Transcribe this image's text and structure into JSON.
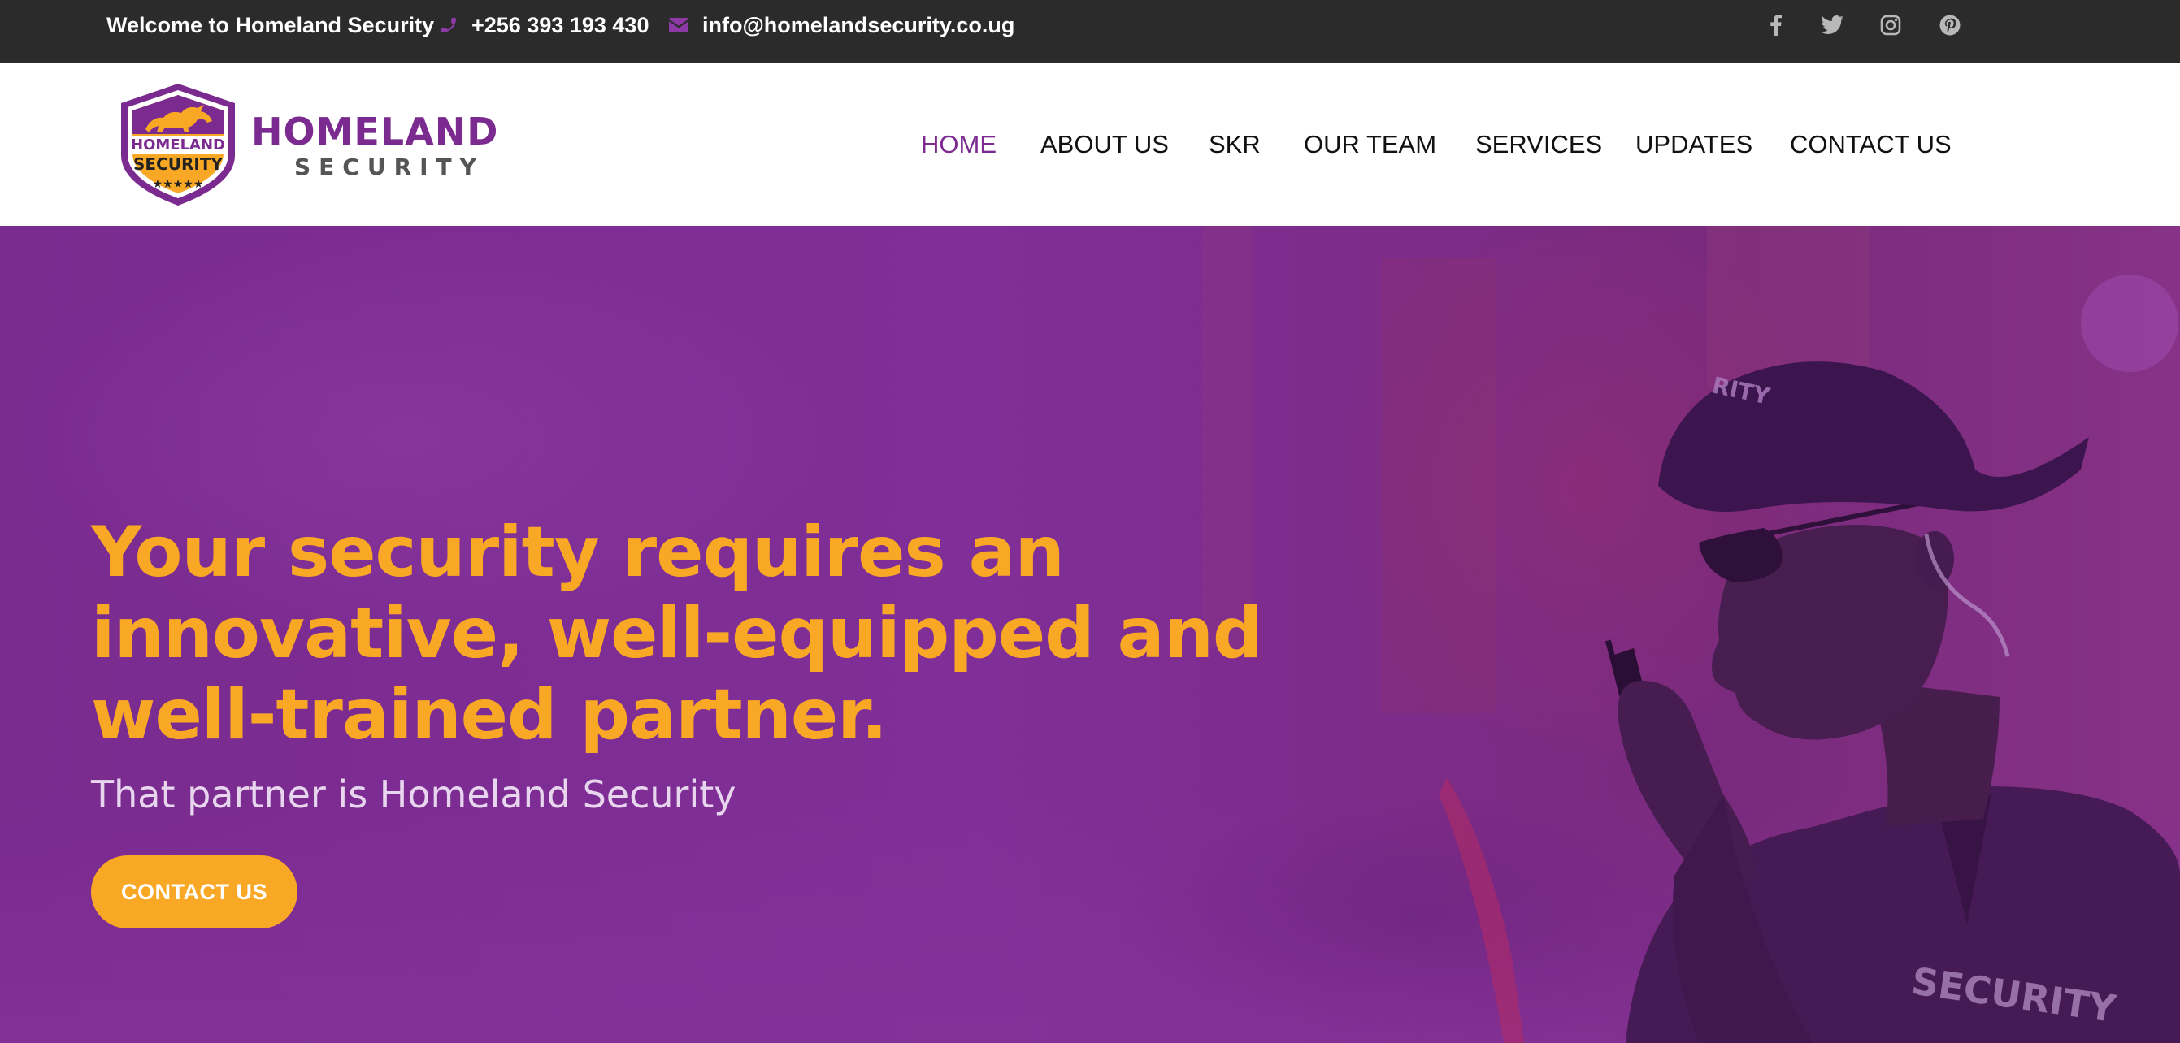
{
  "topbar": {
    "welcome": "Welcome to Homeland Security",
    "phone": "+256 393 193 430",
    "email": "info@homelandsecurity.co.ug",
    "icons": {
      "phone": "phone-icon",
      "email": "envelope-icon"
    },
    "social": [
      "facebook-icon",
      "twitter-icon",
      "instagram-icon",
      "pinterest-icon"
    ]
  },
  "logo": {
    "badge_line1": "HOMELAND",
    "badge_line2": "SECURITY",
    "word1": "HOMELAND",
    "word2": "SECURITY"
  },
  "nav": {
    "items": [
      "HOME",
      "ABOUT US",
      "SKR",
      "OUR TEAM",
      "SERVICES",
      "UPDATES",
      "CONTACT US"
    ],
    "active": "HOME"
  },
  "hero": {
    "title": "Your security requires an innovative, well-equipped and well-trained partner.",
    "subtitle": "That partner is Homeland Security",
    "cta": "CONTACT US",
    "jacket_text": "SECURITY",
    "cap_text": "RITY"
  },
  "colors": {
    "topbar_bg": "#2b2b2b",
    "brand_purple": "#7b2a8f",
    "accent_orange": "#f9a825",
    "hero_overlay": "#7a2d91",
    "nav_text": "#111111",
    "white": "#ffffff"
  }
}
